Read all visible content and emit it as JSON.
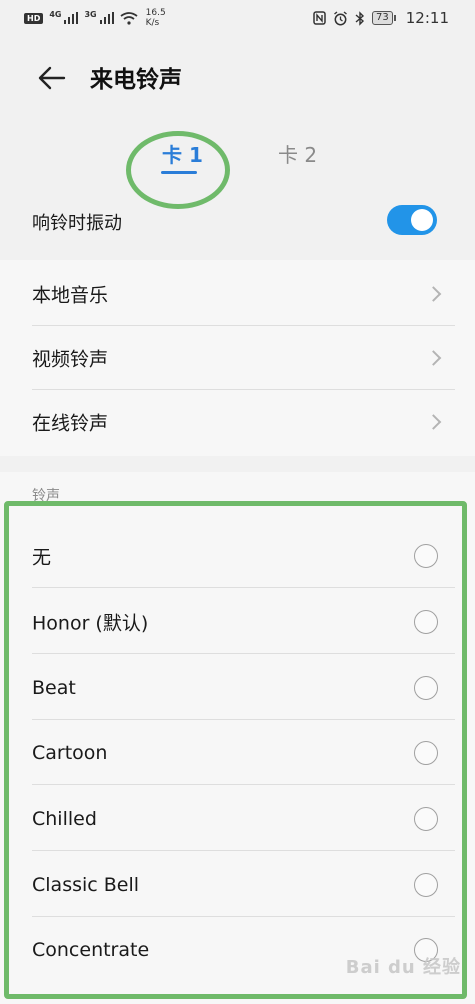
{
  "status_bar": {
    "hd_badge": "HD",
    "net1": "4G",
    "net2": "3G",
    "speed_value": "16.5",
    "speed_unit": "K/s",
    "battery": "73",
    "time": "12:11"
  },
  "header": {
    "title": "来电铃声"
  },
  "tabs": [
    {
      "label": "卡 1",
      "active": true
    },
    {
      "label": "卡 2",
      "active": false
    }
  ],
  "vibrate": {
    "label": "响铃时振动",
    "enabled": true
  },
  "sources": [
    {
      "label": "本地音乐"
    },
    {
      "label": "视频铃声"
    },
    {
      "label": "在线铃声"
    }
  ],
  "ringtones": {
    "section_label": "铃声",
    "items": [
      {
        "label": "无"
      },
      {
        "label": "Honor (默认)"
      },
      {
        "label": "Beat"
      },
      {
        "label": "Cartoon"
      },
      {
        "label": "Chilled"
      },
      {
        "label": "Classic Bell"
      },
      {
        "label": "Concentrate"
      }
    ]
  },
  "watermark": "Bai du 经验",
  "colors": {
    "accent": "#2a7dd8",
    "toggle_on": "#2294e8",
    "annotation": "#6fba6a"
  }
}
